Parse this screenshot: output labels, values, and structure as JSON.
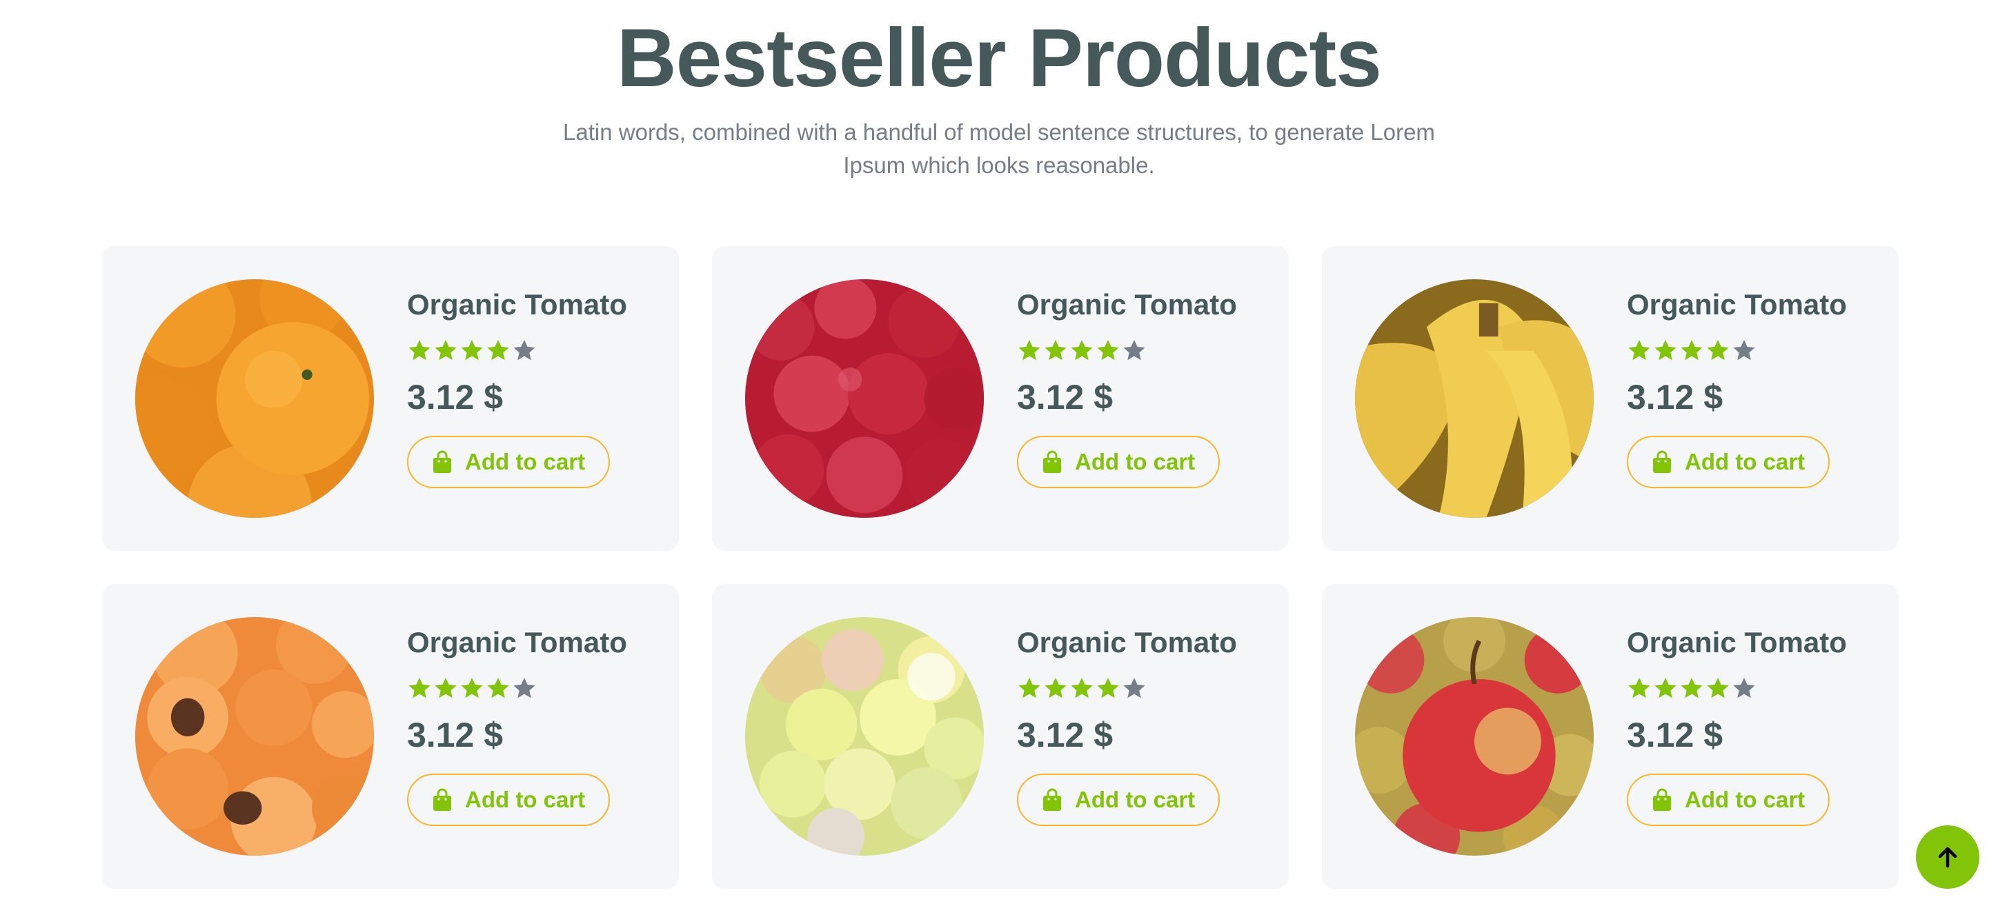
{
  "section": {
    "title": "Bestseller Products",
    "subtitle": "Latin words, combined with a handful of model sentence structures, to generate Lorem Ipsum which looks reasonable."
  },
  "colors": {
    "accent_green": "#81c408",
    "accent_orange": "#ffb524",
    "text_dark": "#45595b",
    "text_muted": "#747d88",
    "card_bg": "#f4f6f8",
    "star_empty": "#747d88"
  },
  "products": [
    {
      "name": "Organic Tomato",
      "price": "3.12 $",
      "rating": 4,
      "rating_max": 5,
      "image": "oranges",
      "cart_label": "Add to cart"
    },
    {
      "name": "Organic Tomato",
      "price": "3.12 $",
      "rating": 4,
      "rating_max": 5,
      "image": "raspberries",
      "cart_label": "Add to cart"
    },
    {
      "name": "Organic Tomato",
      "price": "3.12 $",
      "rating": 4,
      "rating_max": 5,
      "image": "bananas",
      "cart_label": "Add to cart"
    },
    {
      "name": "Organic Tomato",
      "price": "3.12 $",
      "rating": 4,
      "rating_max": 5,
      "image": "apricots",
      "cart_label": "Add to cart"
    },
    {
      "name": "Organic Tomato",
      "price": "3.12 $",
      "rating": 4,
      "rating_max": 5,
      "image": "grapes",
      "cart_label": "Add to cart"
    },
    {
      "name": "Organic Tomato",
      "price": "3.12 $",
      "rating": 4,
      "rating_max": 5,
      "image": "apples",
      "cart_label": "Add to cart"
    }
  ],
  "icons": {
    "cart": "shopping-bag-icon",
    "star": "star-icon",
    "back_to_top": "arrow-up-icon"
  }
}
